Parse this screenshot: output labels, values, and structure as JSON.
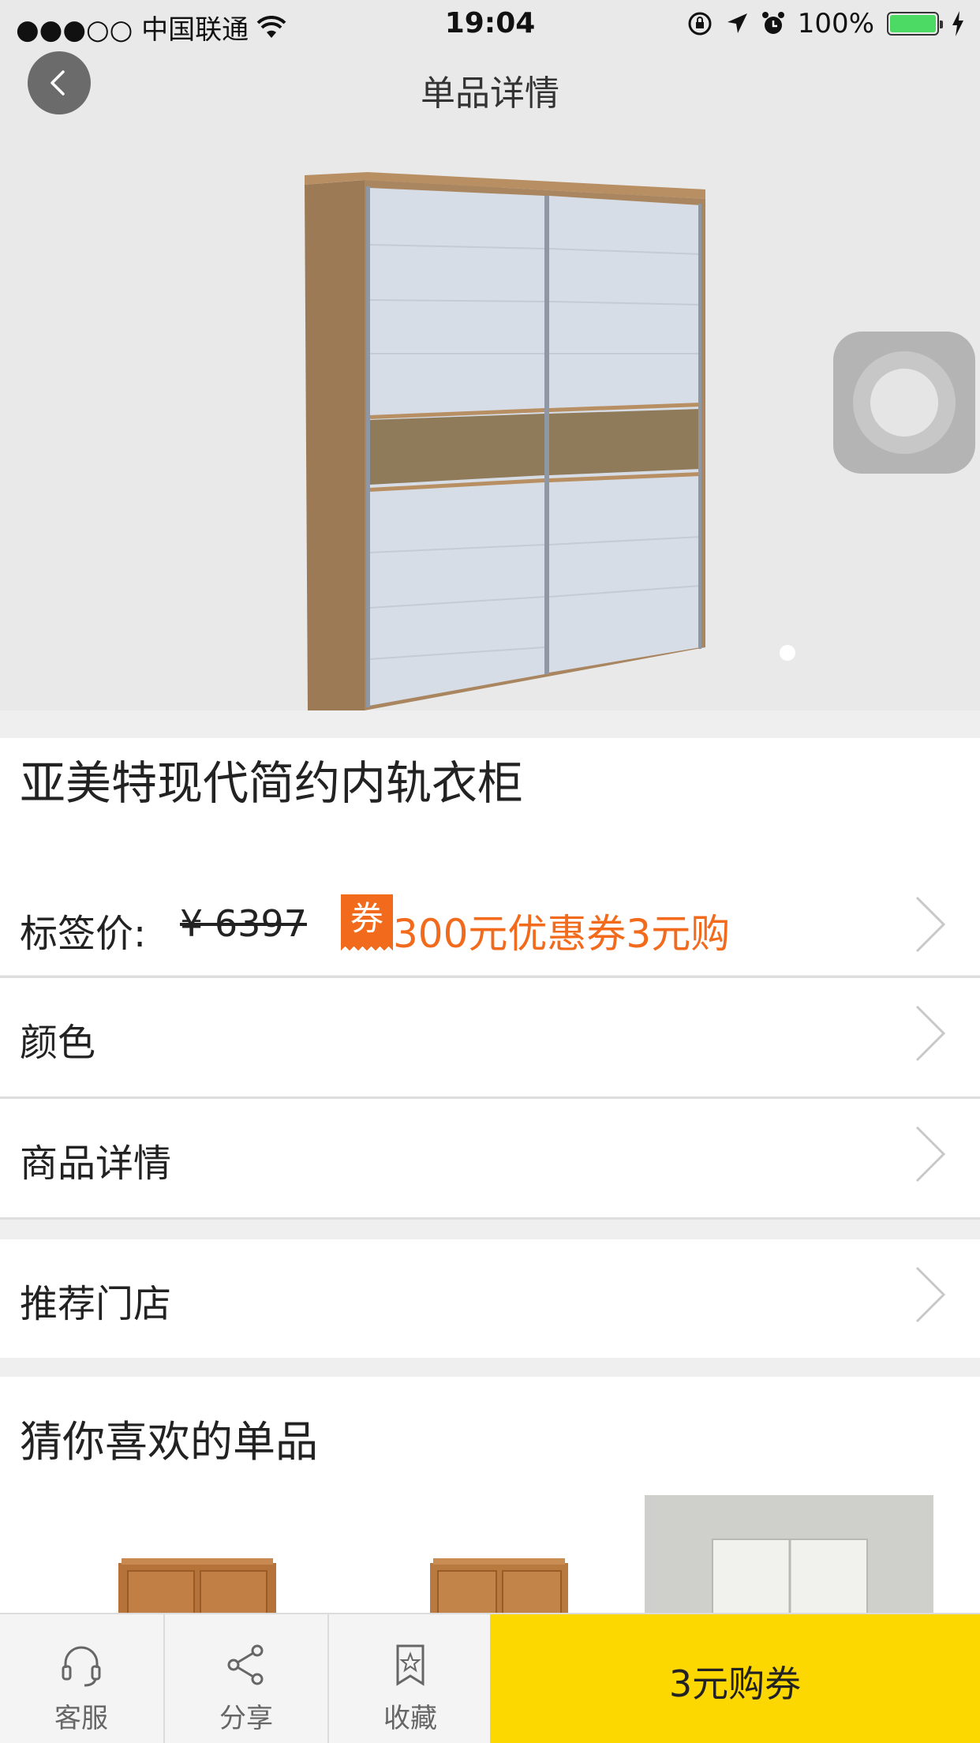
{
  "status_bar": {
    "carrier": "●●●○○ 中国联通",
    "time": "19:04",
    "battery": "100%"
  },
  "nav": {
    "title": "单品详情"
  },
  "product": {
    "title": "亚美特现代简约内轨衣柜",
    "price_label": "标签价:",
    "price_old": "¥ 6397",
    "coupon_badge": "券",
    "coupon_text": "300元优惠券3元购"
  },
  "rows": {
    "color": "颜色",
    "details": "商品详情",
    "stores": "推荐门店"
  },
  "recommend": {
    "title": "猜你喜欢的单品"
  },
  "bottom_bar": {
    "service": "客服",
    "share": "分享",
    "favorite": "收藏",
    "buy": "3元购券"
  },
  "colors": {
    "accent_orange": "#f26b1d",
    "buy_yellow": "#fdd800"
  },
  "icons": [
    "wifi-icon",
    "orientation-lock-icon",
    "location-icon",
    "alarm-icon",
    "charging-icon",
    "back-icon",
    "chevron-right-icon",
    "headset-icon",
    "share-icon",
    "bookmark-star-icon"
  ]
}
